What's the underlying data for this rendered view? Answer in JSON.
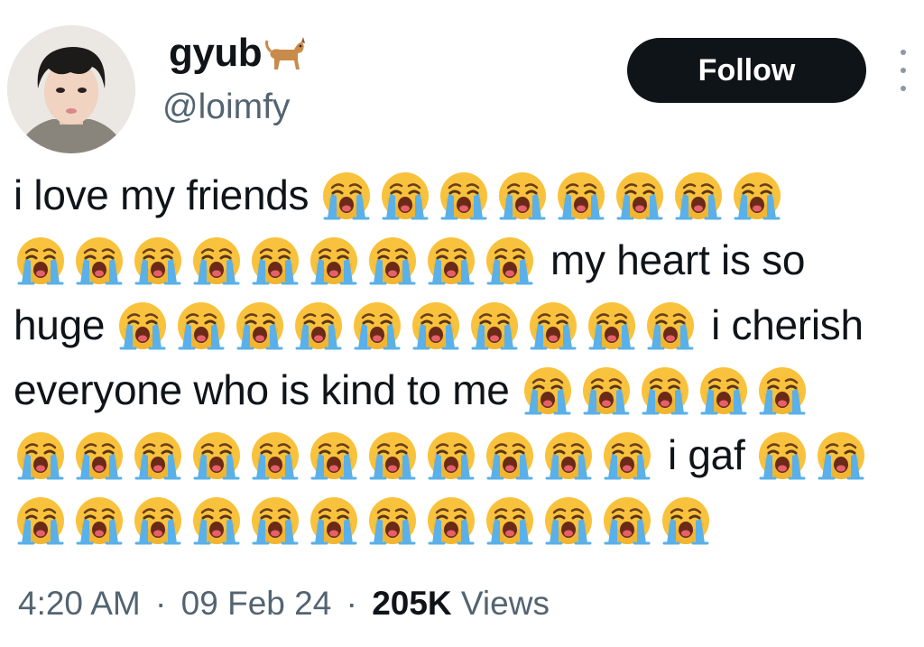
{
  "header": {
    "display_name": "gyub",
    "handle": "@loimfy",
    "follow_label": "Follow",
    "name_icon": "dog-icon"
  },
  "body": {
    "emoji_icon": "loudly-crying-face-emoji",
    "lines": [
      {
        "segments": [
          {
            "t": "text",
            "v": "i love my friends"
          },
          {
            "t": "emoji",
            "n": 8
          }
        ]
      },
      {
        "segments": [
          {
            "t": "emoji",
            "n": 9
          },
          {
            "t": "text",
            "v": "my heart is so"
          }
        ]
      },
      {
        "segments": [
          {
            "t": "text",
            "v": "huge"
          },
          {
            "t": "emoji",
            "n": 10
          },
          {
            "t": "text",
            "v": "i cherish"
          }
        ]
      },
      {
        "segments": [
          {
            "t": "text",
            "v": "everyone who is kind to me"
          },
          {
            "t": "emoji",
            "n": 5
          }
        ]
      },
      {
        "segments": [
          {
            "t": "emoji",
            "n": 11
          },
          {
            "t": "text",
            "v": "i gaf"
          },
          {
            "t": "emoji",
            "n": 2
          }
        ]
      },
      {
        "segments": [
          {
            "t": "emoji",
            "n": 12
          }
        ]
      }
    ]
  },
  "footer": {
    "time": "4:20 AM",
    "separator": "·",
    "date": "09 Feb 24",
    "views_count": "205K",
    "views_label": "Views"
  },
  "colors": {
    "follow_bg": "#0f1419",
    "secondary_text": "#536471",
    "emoji_face": "#f9c23c",
    "emoji_tears": "#5ab0e8"
  }
}
